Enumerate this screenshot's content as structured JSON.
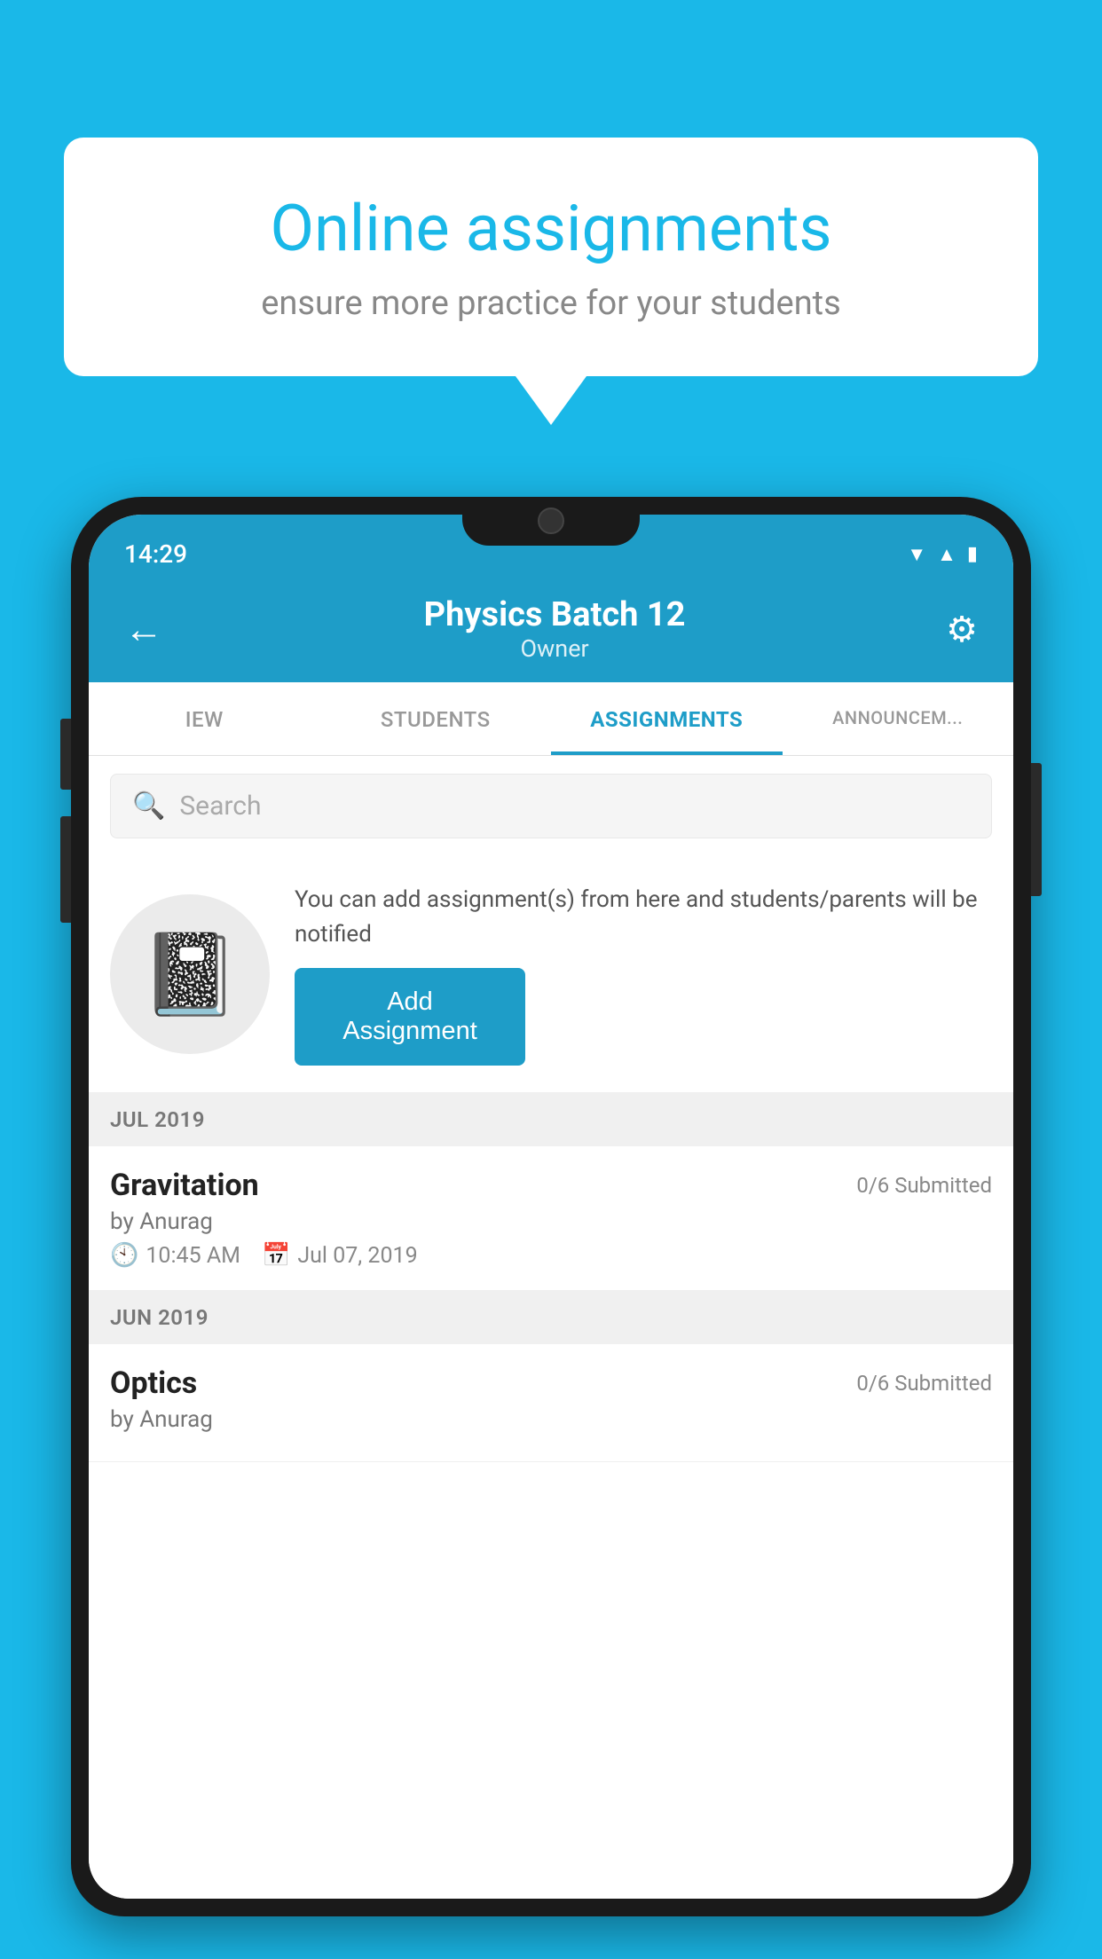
{
  "background_color": "#1ab8e8",
  "speech_bubble": {
    "title": "Online assignments",
    "subtitle": "ensure more practice for your students"
  },
  "phone": {
    "status_bar": {
      "time": "14:29",
      "icons": [
        "wifi",
        "signal",
        "battery"
      ]
    },
    "header": {
      "title": "Physics Batch 12",
      "subtitle": "Owner",
      "back_label": "←",
      "settings_label": "⚙"
    },
    "tabs": [
      {
        "label": "IEW",
        "active": false
      },
      {
        "label": "STUDENTS",
        "active": false
      },
      {
        "label": "ASSIGNMENTS",
        "active": true
      },
      {
        "label": "ANNOUNCEM...",
        "active": false
      }
    ],
    "search": {
      "placeholder": "Search"
    },
    "add_assignment_card": {
      "description": "You can add assignment(s) from here and students/parents will be notified",
      "button_label": "Add Assignment"
    },
    "sections": [
      {
        "header": "JUL 2019",
        "items": [
          {
            "title": "Gravitation",
            "submitted": "0/6 Submitted",
            "author": "by Anurag",
            "time": "10:45 AM",
            "date": "Jul 07, 2019"
          }
        ]
      },
      {
        "header": "JUN 2019",
        "items": [
          {
            "title": "Optics",
            "submitted": "0/6 Submitted",
            "author": "by Anurag",
            "time": "",
            "date": ""
          }
        ]
      }
    ]
  }
}
